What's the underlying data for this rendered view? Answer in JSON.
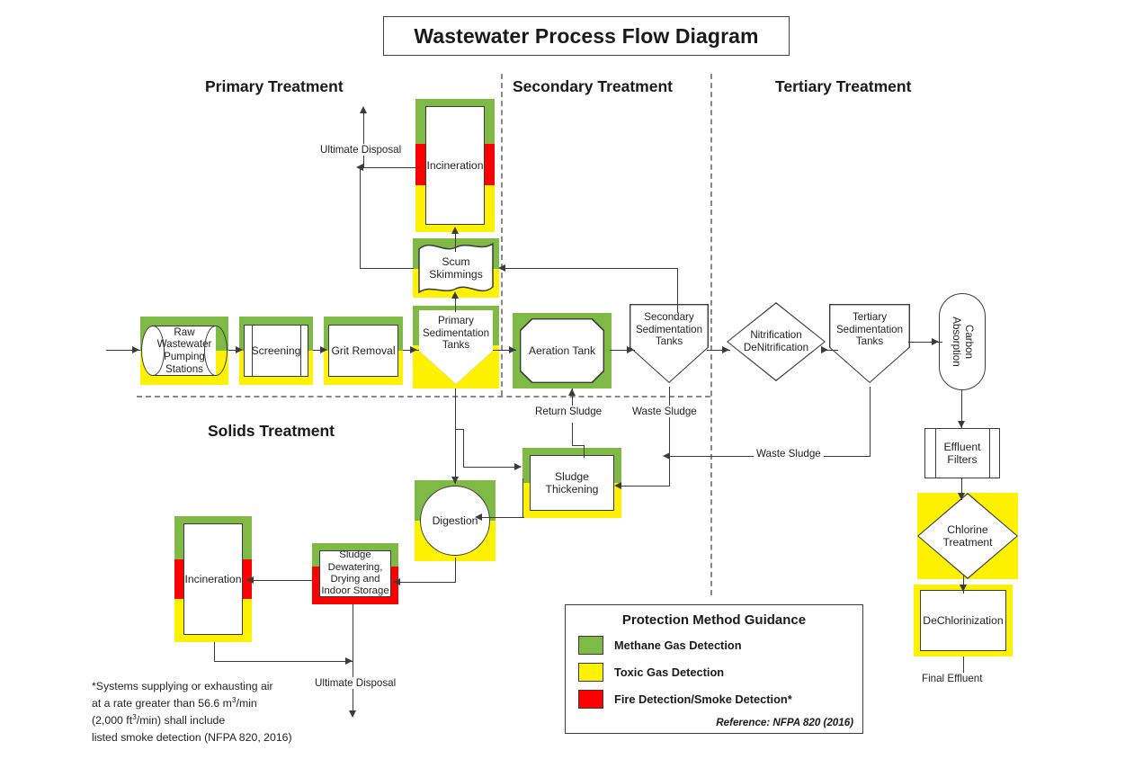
{
  "title": "Wastewater Process Flow Diagram",
  "sections": [
    {
      "key": "primary",
      "label": "Primary Treatment"
    },
    {
      "key": "secondary",
      "label": "Secondary Treatment"
    },
    {
      "key": "tertiary",
      "label": "Tertiary Treatment"
    },
    {
      "key": "solids",
      "label": "Solids Treatment"
    }
  ],
  "nodes": {
    "raw_pumping": "Raw\nWastewater\nPumping\nStations",
    "screening": "Screening",
    "grit_removal": "Grit Removal",
    "primary_sed": "Primary\nSedimentation\nTanks",
    "scum_skimmings": "Scum\nSkimmings",
    "incineration_top": "Incineration",
    "aeration_tank": "Aeration Tank",
    "secondary_sed": "Secondary\nSedimentation\nTanks",
    "nitrification": "Nitrification\nDeNitrification",
    "tertiary_sed": "Tertiary\nSedimentation\nTanks",
    "carbon_absorption": "Carbon\nAbsorption",
    "effluent_filters": "Effluent\nFilters",
    "chlorine_treatment": "Chlorine\nTreatment",
    "dechlorinization": "DeChlorinization",
    "digestion": "Digestion",
    "sludge_thickening": "Sludge\nThickening",
    "sludge_dewatering": "Sludge\nDewatering,\nDrying and\nIndoor Storage",
    "incineration_bottom": "Incineration"
  },
  "flow_labels": {
    "ultimate_disposal_top": "Ultimate Disposal",
    "ultimate_disposal_bottom": "Ultimate Disposal",
    "return_sludge": "Return Sludge",
    "waste_sludge_secondary": "Waste Sludge",
    "waste_sludge_tertiary": "Waste Sludge",
    "final_effluent": "Final Effluent"
  },
  "legend": {
    "title": "Protection Method Guidance",
    "items": [
      {
        "color": "#7FBA47",
        "label": "Methane Gas Detection"
      },
      {
        "color": "#FFF200",
        "label": "Toxic Gas Detection"
      },
      {
        "color": "#FF0000",
        "label": "Fire Detection/Smoke Detection*"
      }
    ],
    "reference": "Reference:  NFPA 820 (2016)"
  },
  "footnote": {
    "line1": "*Systems supplying or exhausting air",
    "line2_a": "at a rate greater than 56.6 m",
    "line2_sup": "3",
    "line2_b": "/min",
    "line3_a": "(2,000 ft",
    "line3_sup": "3",
    "line3_b": "/min) shall include",
    "line4": "listed smoke detection (NFPA 820, 2016)"
  },
  "colors": {
    "methane_green": "#7FBA47",
    "toxic_yellow": "#FFF200",
    "fire_red": "#FF0000",
    "line": "#3b3b3b"
  }
}
